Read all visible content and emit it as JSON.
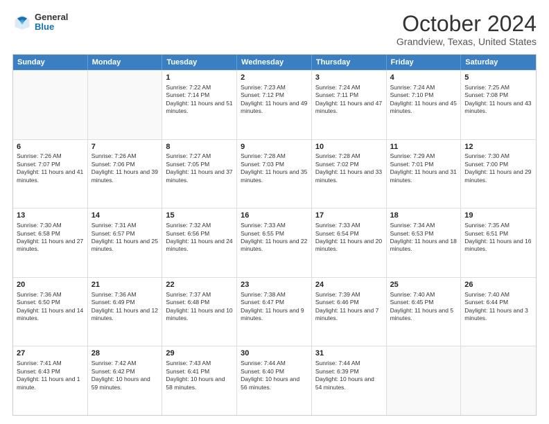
{
  "header": {
    "logo_general": "General",
    "logo_blue": "Blue",
    "month_title": "October 2024",
    "location": "Grandview, Texas, United States"
  },
  "calendar": {
    "days_of_week": [
      "Sunday",
      "Monday",
      "Tuesday",
      "Wednesday",
      "Thursday",
      "Friday",
      "Saturday"
    ],
    "rows": [
      [
        {
          "day": "",
          "info": "",
          "empty": true
        },
        {
          "day": "",
          "info": "",
          "empty": true
        },
        {
          "day": "1",
          "info": "Sunrise: 7:22 AM\nSunset: 7:14 PM\nDaylight: 11 hours and 51 minutes."
        },
        {
          "day": "2",
          "info": "Sunrise: 7:23 AM\nSunset: 7:12 PM\nDaylight: 11 hours and 49 minutes."
        },
        {
          "day": "3",
          "info": "Sunrise: 7:24 AM\nSunset: 7:11 PM\nDaylight: 11 hours and 47 minutes."
        },
        {
          "day": "4",
          "info": "Sunrise: 7:24 AM\nSunset: 7:10 PM\nDaylight: 11 hours and 45 minutes."
        },
        {
          "day": "5",
          "info": "Sunrise: 7:25 AM\nSunset: 7:08 PM\nDaylight: 11 hours and 43 minutes."
        }
      ],
      [
        {
          "day": "6",
          "info": "Sunrise: 7:26 AM\nSunset: 7:07 PM\nDaylight: 11 hours and 41 minutes."
        },
        {
          "day": "7",
          "info": "Sunrise: 7:26 AM\nSunset: 7:06 PM\nDaylight: 11 hours and 39 minutes."
        },
        {
          "day": "8",
          "info": "Sunrise: 7:27 AM\nSunset: 7:05 PM\nDaylight: 11 hours and 37 minutes."
        },
        {
          "day": "9",
          "info": "Sunrise: 7:28 AM\nSunset: 7:03 PM\nDaylight: 11 hours and 35 minutes."
        },
        {
          "day": "10",
          "info": "Sunrise: 7:28 AM\nSunset: 7:02 PM\nDaylight: 11 hours and 33 minutes."
        },
        {
          "day": "11",
          "info": "Sunrise: 7:29 AM\nSunset: 7:01 PM\nDaylight: 11 hours and 31 minutes."
        },
        {
          "day": "12",
          "info": "Sunrise: 7:30 AM\nSunset: 7:00 PM\nDaylight: 11 hours and 29 minutes."
        }
      ],
      [
        {
          "day": "13",
          "info": "Sunrise: 7:30 AM\nSunset: 6:58 PM\nDaylight: 11 hours and 27 minutes."
        },
        {
          "day": "14",
          "info": "Sunrise: 7:31 AM\nSunset: 6:57 PM\nDaylight: 11 hours and 25 minutes."
        },
        {
          "day": "15",
          "info": "Sunrise: 7:32 AM\nSunset: 6:56 PM\nDaylight: 11 hours and 24 minutes."
        },
        {
          "day": "16",
          "info": "Sunrise: 7:33 AM\nSunset: 6:55 PM\nDaylight: 11 hours and 22 minutes."
        },
        {
          "day": "17",
          "info": "Sunrise: 7:33 AM\nSunset: 6:54 PM\nDaylight: 11 hours and 20 minutes."
        },
        {
          "day": "18",
          "info": "Sunrise: 7:34 AM\nSunset: 6:53 PM\nDaylight: 11 hours and 18 minutes."
        },
        {
          "day": "19",
          "info": "Sunrise: 7:35 AM\nSunset: 6:51 PM\nDaylight: 11 hours and 16 minutes."
        }
      ],
      [
        {
          "day": "20",
          "info": "Sunrise: 7:36 AM\nSunset: 6:50 PM\nDaylight: 11 hours and 14 minutes."
        },
        {
          "day": "21",
          "info": "Sunrise: 7:36 AM\nSunset: 6:49 PM\nDaylight: 11 hours and 12 minutes."
        },
        {
          "day": "22",
          "info": "Sunrise: 7:37 AM\nSunset: 6:48 PM\nDaylight: 11 hours and 10 minutes."
        },
        {
          "day": "23",
          "info": "Sunrise: 7:38 AM\nSunset: 6:47 PM\nDaylight: 11 hours and 9 minutes."
        },
        {
          "day": "24",
          "info": "Sunrise: 7:39 AM\nSunset: 6:46 PM\nDaylight: 11 hours and 7 minutes."
        },
        {
          "day": "25",
          "info": "Sunrise: 7:40 AM\nSunset: 6:45 PM\nDaylight: 11 hours and 5 minutes."
        },
        {
          "day": "26",
          "info": "Sunrise: 7:40 AM\nSunset: 6:44 PM\nDaylight: 11 hours and 3 minutes."
        }
      ],
      [
        {
          "day": "27",
          "info": "Sunrise: 7:41 AM\nSunset: 6:43 PM\nDaylight: 11 hours and 1 minute."
        },
        {
          "day": "28",
          "info": "Sunrise: 7:42 AM\nSunset: 6:42 PM\nDaylight: 10 hours and 59 minutes."
        },
        {
          "day": "29",
          "info": "Sunrise: 7:43 AM\nSunset: 6:41 PM\nDaylight: 10 hours and 58 minutes."
        },
        {
          "day": "30",
          "info": "Sunrise: 7:44 AM\nSunset: 6:40 PM\nDaylight: 10 hours and 56 minutes."
        },
        {
          "day": "31",
          "info": "Sunrise: 7:44 AM\nSunset: 6:39 PM\nDaylight: 10 hours and 54 minutes."
        },
        {
          "day": "",
          "info": "",
          "empty": true
        },
        {
          "day": "",
          "info": "",
          "empty": true
        }
      ]
    ]
  }
}
